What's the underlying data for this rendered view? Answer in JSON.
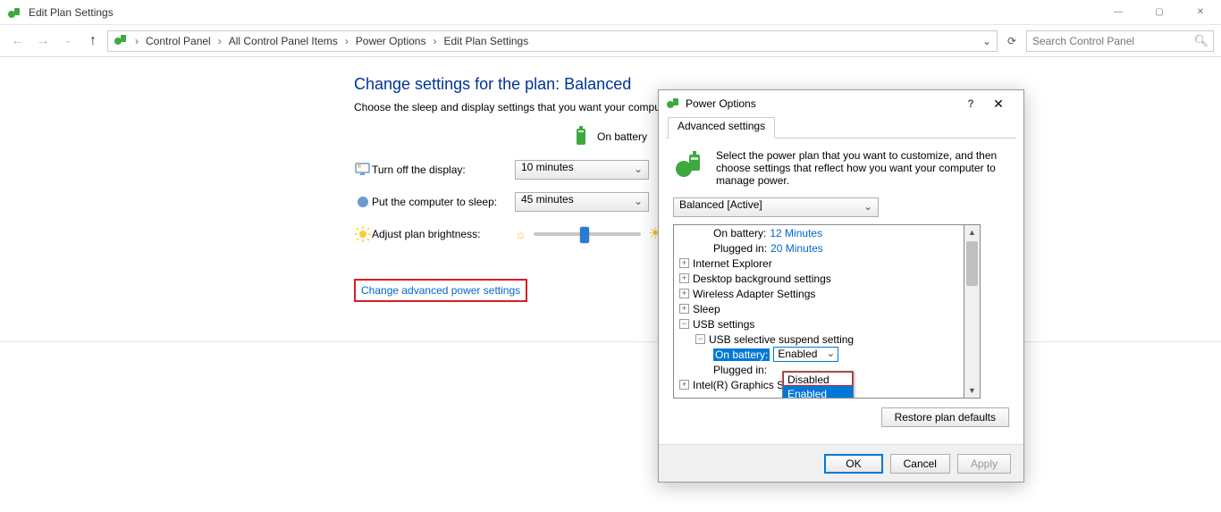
{
  "window": {
    "title": "Edit Plan Settings"
  },
  "nav": {
    "breadcrumbs": [
      "Control Panel",
      "All Control Panel Items",
      "Power Options",
      "Edit Plan Settings"
    ],
    "search_placeholder": "Search Control Panel"
  },
  "page": {
    "heading": "Change settings for the plan: Balanced",
    "subtext": "Choose the sleep and display settings that you want your computer to use.",
    "col_battery": "On battery",
    "rows": {
      "display_label": "Turn off the display:",
      "display_value": "10 minutes",
      "sleep_label": "Put the computer to sleep:",
      "sleep_value": "45 minutes",
      "brightness_label": "Adjust plan brightness:"
    },
    "advanced_link": "Change advanced power settings"
  },
  "dialog": {
    "title": "Power Options",
    "tab": "Advanced settings",
    "desc": "Select the power plan that you want to customize, and then choose settings that reflect how you want your computer to manage power.",
    "plan": "Balanced [Active]",
    "tree": {
      "on_battery_top": "On battery:",
      "on_battery_top_val": "12 Minutes",
      "plugged_in_top": "Plugged in:",
      "plugged_in_top_val": "20 Minutes",
      "ie": "Internet Explorer",
      "desktop_bg": "Desktop background settings",
      "wireless": "Wireless Adapter Settings",
      "sleep": "Sleep",
      "usb": "USB settings",
      "usb_suspend": "USB selective suspend setting",
      "usb_on_battery": "On battery:",
      "usb_on_battery_val": "Enabled",
      "usb_plugged_in": "Plugged in:",
      "intel": "Intel(R) Graphics Settings"
    },
    "dd_options": {
      "disabled": "Disabled",
      "enabled": "Enabled"
    },
    "buttons": {
      "restore": "Restore plan defaults",
      "ok": "OK",
      "cancel": "Cancel",
      "apply": "Apply"
    }
  }
}
